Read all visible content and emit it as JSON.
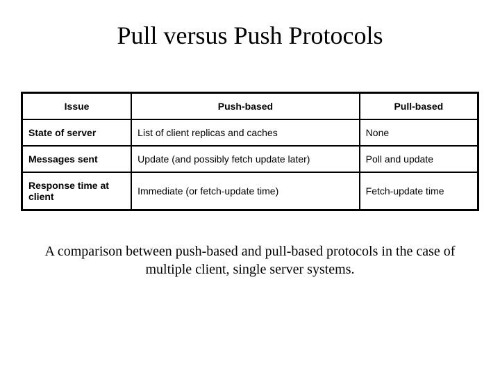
{
  "title": "Pull versus Push Protocols",
  "table": {
    "headers": [
      "Issue",
      "Push-based",
      "Pull-based"
    ],
    "rows": [
      {
        "issue": "State of server",
        "push": "List of client replicas and caches",
        "pull": "None"
      },
      {
        "issue": "Messages sent",
        "push": "Update (and possibly fetch update later)",
        "pull": "Poll and update"
      },
      {
        "issue": "Response time at client",
        "push": "Immediate (or fetch-update time)",
        "pull": "Fetch-update time"
      }
    ]
  },
  "caption": "A comparison between push-based and pull-based protocols in the case of multiple client, single server systems."
}
